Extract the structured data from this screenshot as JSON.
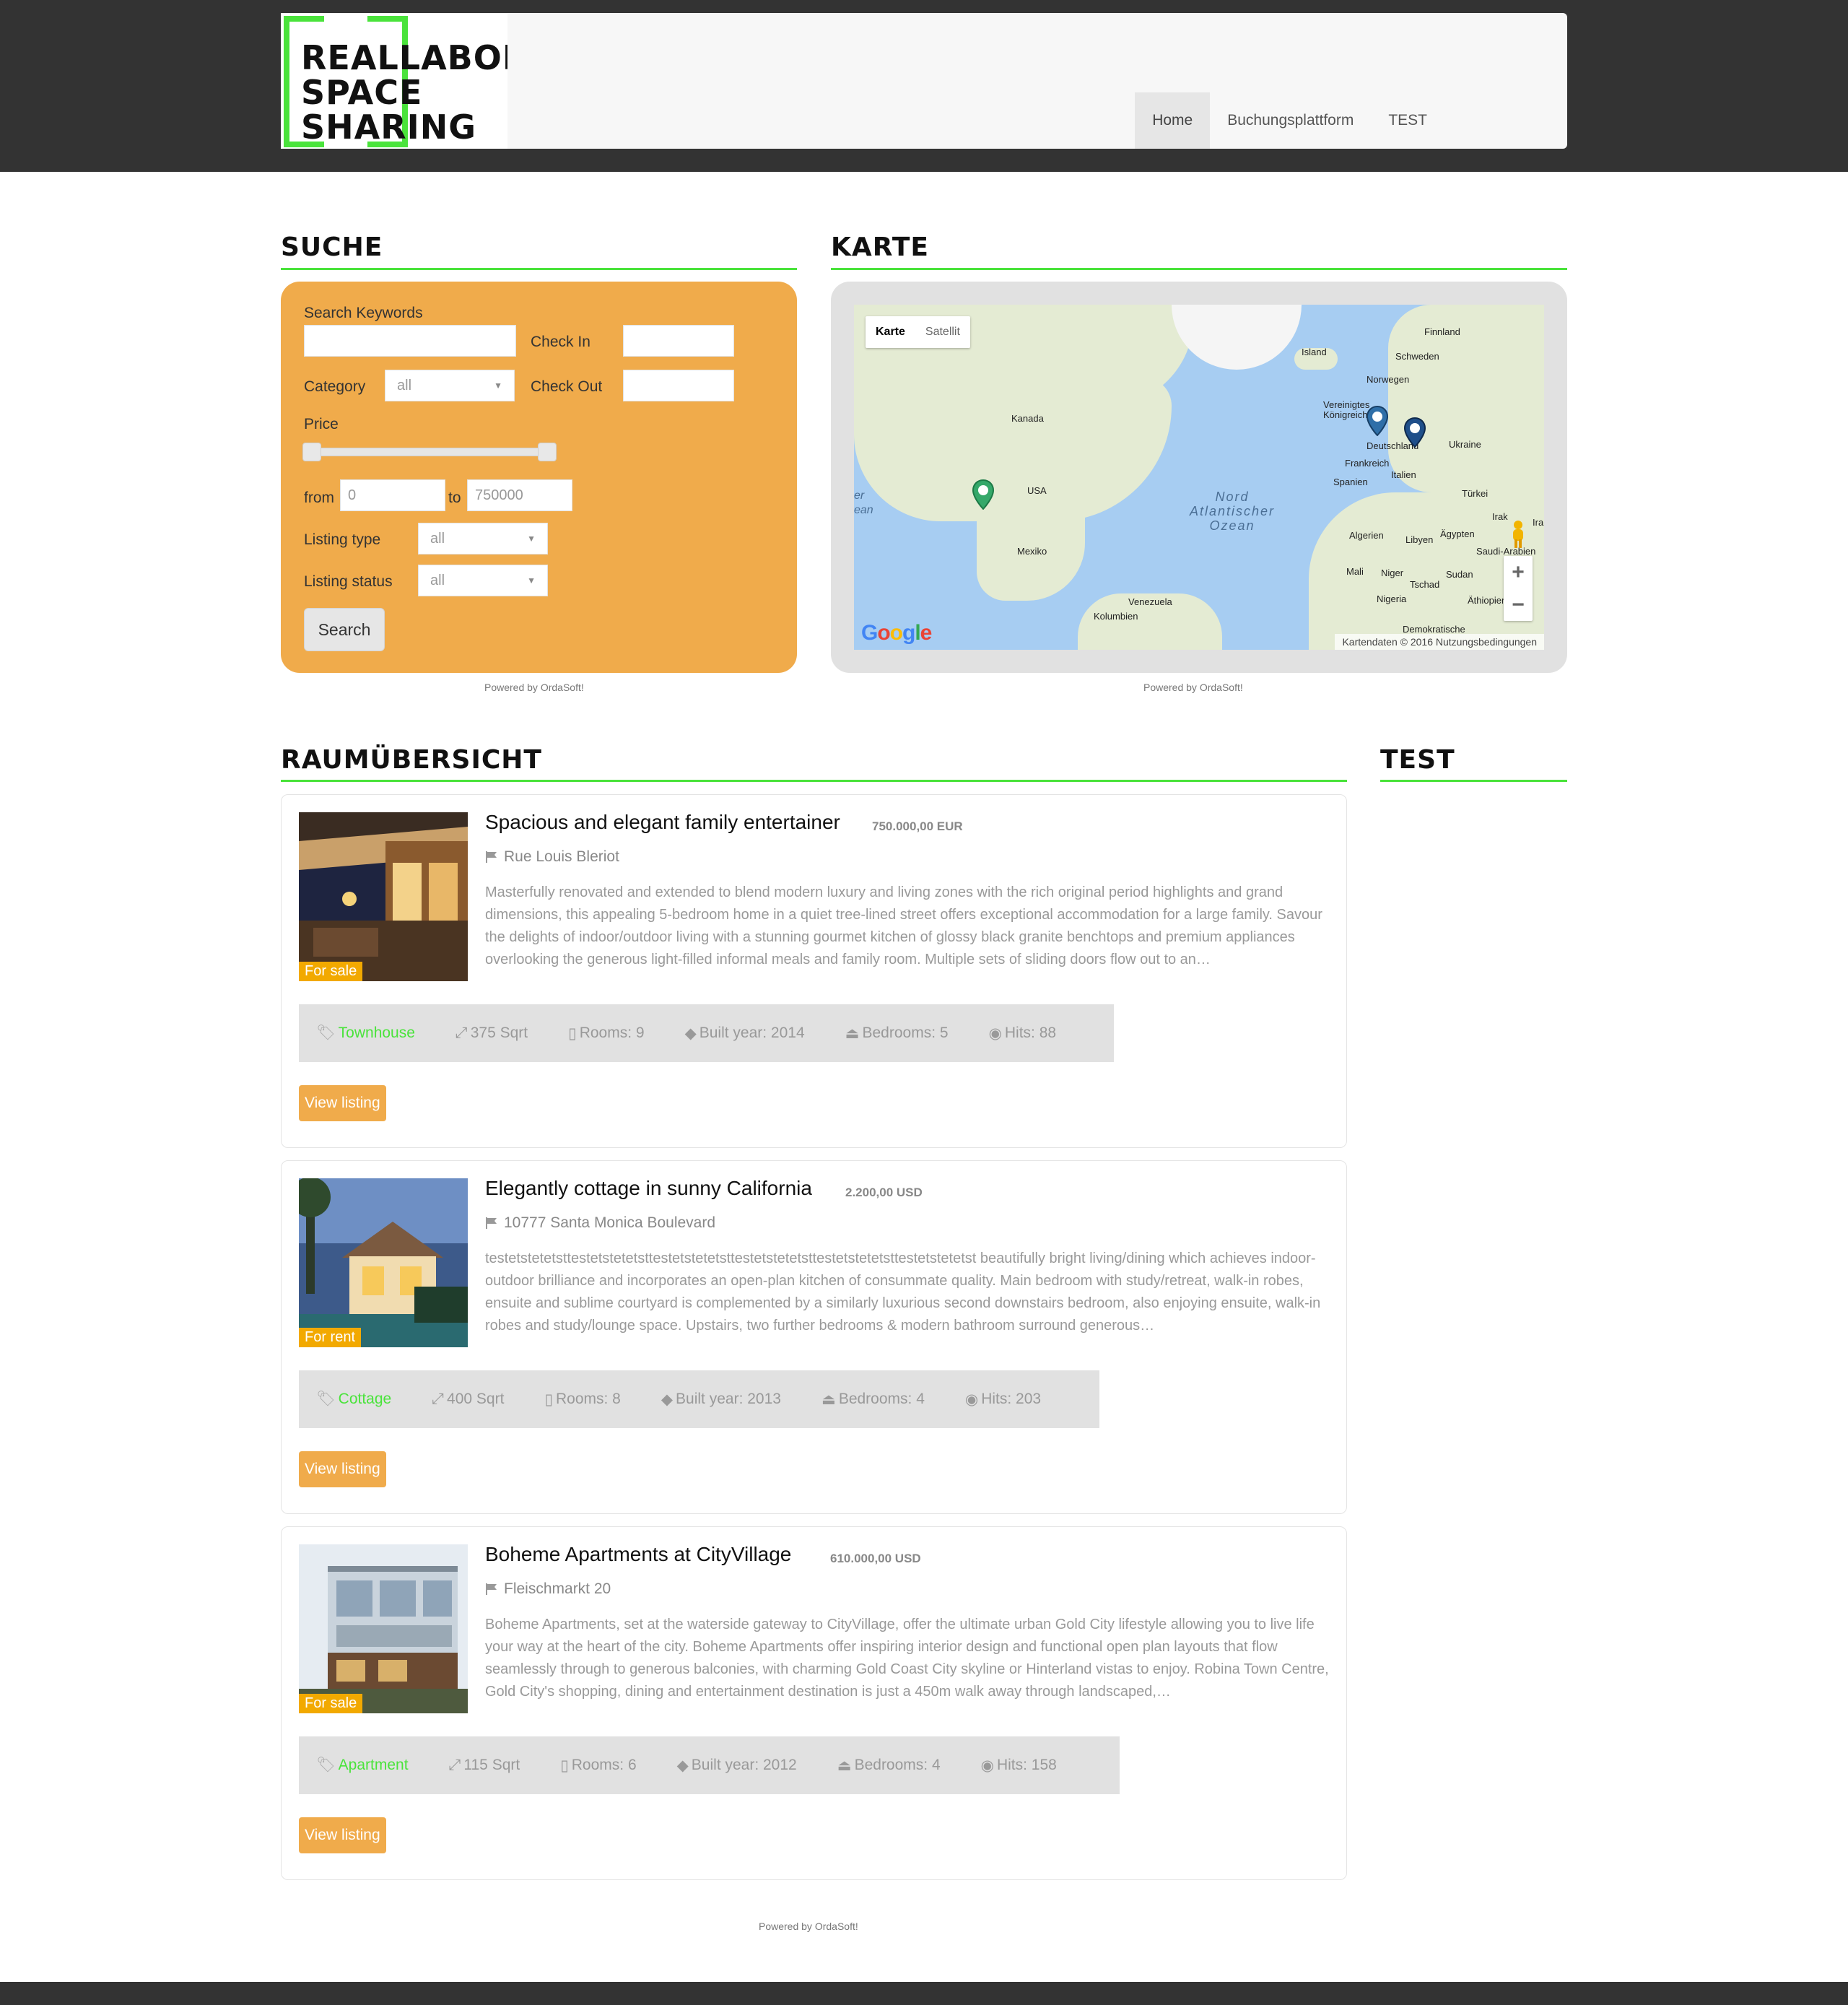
{
  "header": {
    "logo_lines": [
      "REALLABOR",
      "SPACE",
      "SHARING"
    ],
    "nav": [
      {
        "label": "Home",
        "active": true
      },
      {
        "label": "Buchungsplattform",
        "active": false
      },
      {
        "label": "TEST",
        "active": false
      }
    ]
  },
  "search": {
    "title": "SUCHE",
    "keywords_label": "Search Keywords",
    "keywords_value": "",
    "checkin_label": "Check In",
    "checkout_label": "Check Out",
    "category_label": "Category",
    "category_value": "all",
    "price_label": "Price",
    "from_label": "from",
    "from_value": "0",
    "to_label": "to",
    "to_value": "750000",
    "listing_type_label": "Listing type",
    "listing_type_value": "all",
    "listing_status_label": "Listing status",
    "listing_status_value": "all",
    "button": "Search",
    "powered": "Powered by OrdaSoft!"
  },
  "map": {
    "title": "KARTE",
    "type_map": "Karte",
    "type_satellite": "Satellit",
    "labels": [
      "Island",
      "Finnland",
      "Schweden",
      "Norwegen",
      "Vereinigtes Königreich",
      "Deutschland",
      "Ukraine",
      "Frankreich",
      "Spanien",
      "Italien",
      "Türkei",
      "Kanada",
      "USA",
      "Mexiko",
      "Algerien",
      "Libyen",
      "Ägypten",
      "Saudi-Arabien",
      "Mali",
      "Niger",
      "Tschad",
      "Sudan",
      "Nigeria",
      "Äthiopien",
      "Venezuela",
      "Kolumbien",
      "Demokratische",
      "Irak",
      "Iran",
      "er",
      "ean"
    ],
    "ocean_label": "Nord Atlantischer Ozean",
    "logo": "Google",
    "attribution": "Kartendaten © 2016   Nutzungsbedingungen",
    "powered": "Powered by OrdaSoft!"
  },
  "listings_section": {
    "title": "RAUMÜBERSICHT",
    "side_title": "TEST"
  },
  "listings": [
    {
      "title": "Spacious and elegant family entertainer",
      "price": "750.000,00 EUR",
      "address": "Rue Louis Bleriot",
      "status": "For sale",
      "description": "Masterfully renovated and extended to blend modern luxury and living zones with the rich original period highlights and grand dimensions, this appealing 5-bedroom home in a quiet tree-lined street offers exceptional accommodation for a large family. Savour the delights of indoor/outdoor living with a stunning gourmet kitchen of glossy black granite benchtops and premium appliances overlooking the generous light-filled informal meals and family room. Multiple sets of sliding doors flow out to an…",
      "category": "Townhouse",
      "size": "375 Sqrt",
      "rooms": "Rooms: 9",
      "built": "Built year: 2014",
      "bedrooms": "Bedrooms: 5",
      "hits": "Hits: 88",
      "button": "View listing"
    },
    {
      "title": "Elegantly cottage in sunny California",
      "price": "2.200,00 USD",
      "address": "10777 Santa Monica Boulevard",
      "status": "For rent",
      "description": "testetstetetsttestetstetetsttestetstetetsttestetstetetsttestetstetetsttestetstetetst beautifully bright living/dining which achieves indoor-outdoor brilliance and incorporates an open-plan kitchen of consummate quality. Main bedroom with study/retreat, walk-in robes, ensuite and sublime courtyard is complemented by a similarly luxurious second downstairs bedroom, also enjoying ensuite, walk-in robes and study/lounge space. Upstairs, two further bedrooms & modern bathroom surround generous…",
      "category": "Cottage",
      "size": "400 Sqrt",
      "rooms": "Rooms: 8",
      "built": "Built year: 2013",
      "bedrooms": "Bedrooms: 4",
      "hits": "Hits: 203",
      "button": "View listing"
    },
    {
      "title": "Boheme Apartments at CityVillage",
      "price": "610.000,00 USD",
      "address": "Fleischmarkt 20",
      "status": "For sale",
      "description": "Boheme Apartments, set at the waterside gateway to CityVillage, offer the ultimate urban Gold City lifestyle allowing you to live life your way at the heart of the city. Boheme Apartments offer inspiring interior design and functional open plan layouts that flow seamlessly through to generous balconies, with charming Gold Coast City skyline or Hinterland vistas to enjoy. Robina Town Centre, Gold City's shopping, dining and entertainment destination is just a 450m walk away through landscaped,…",
      "category": "Apartment",
      "size": "115 Sqrt",
      "rooms": "Rooms: 6",
      "built": "Built year: 2012",
      "bedrooms": "Bedrooms: 4",
      "hits": "Hits: 158",
      "button": "View listing"
    }
  ],
  "footer": {
    "powered": "Powered by OrdaSoft!"
  },
  "colors": {
    "accent_green": "#4ae33b",
    "orange": "#f0ab4b",
    "dark": "#333333"
  }
}
